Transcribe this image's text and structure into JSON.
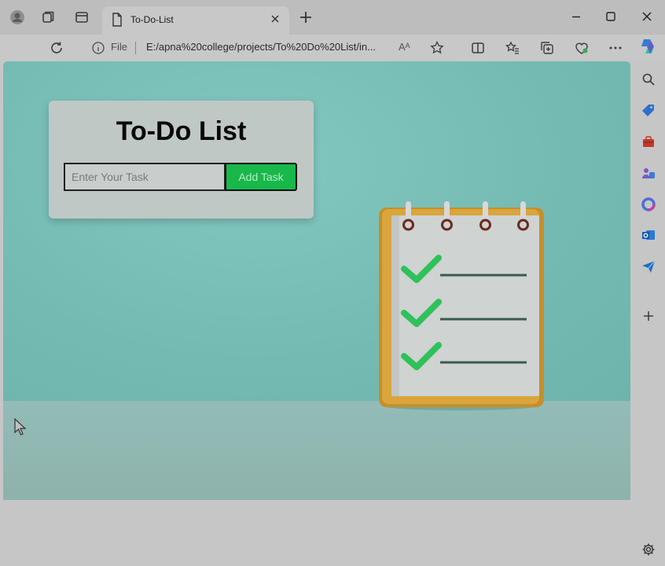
{
  "browser": {
    "tab_title": "To-Do-List",
    "file_label": "File",
    "url": "E:/apna%20college/projects/To%20Do%20List/in...",
    "read_aloud_glyph": "Aᴬ"
  },
  "page": {
    "heading": "To-Do List",
    "task_input_placeholder": "Enter Your Task",
    "add_button_label": "Add Task"
  },
  "colors": {
    "accent_green": "#18b84a",
    "page_teal": "#7cbdb5"
  }
}
